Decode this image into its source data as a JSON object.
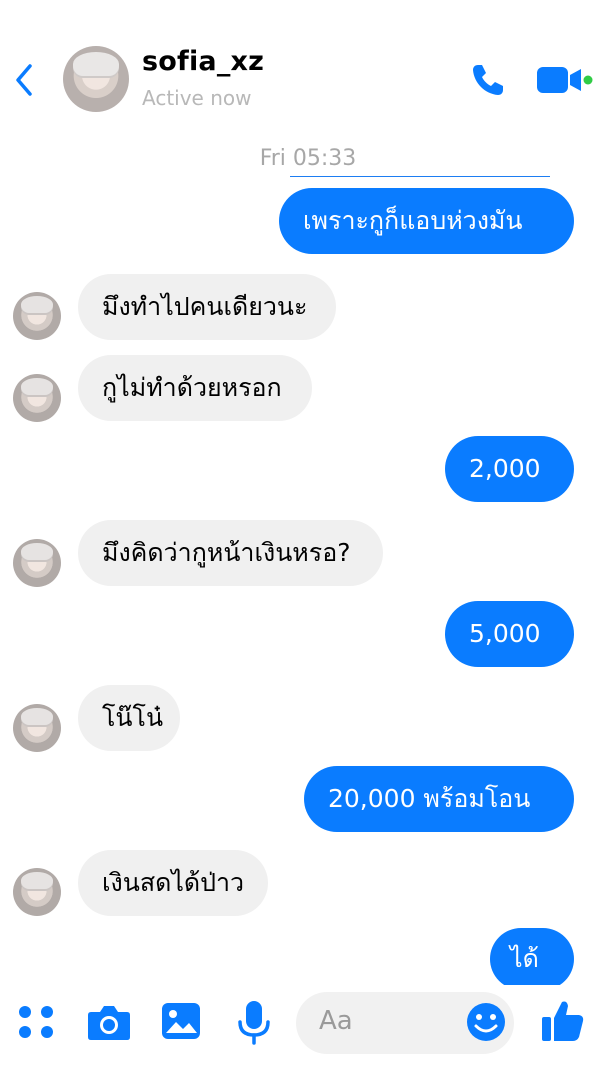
{
  "header": {
    "contact_name": "sofia_xz",
    "status": "Active now"
  },
  "thread": {
    "timestamp": "Fri 05:33",
    "messages": [
      {
        "direction": "outgoing",
        "text": "เพราะกูก็แอบห่วงมัน"
      },
      {
        "direction": "incoming",
        "text": "มึงทำไปคนเดียวนะ"
      },
      {
        "direction": "incoming",
        "text": "กูไม่ทำด้วยหรอก"
      },
      {
        "direction": "outgoing",
        "text": "2,000"
      },
      {
        "direction": "incoming",
        "text": "มึงคิดว่ากูหน้าเงินหรอ?"
      },
      {
        "direction": "outgoing",
        "text": "5,000"
      },
      {
        "direction": "incoming",
        "text": "โน๊โน๋"
      },
      {
        "direction": "outgoing",
        "text": "20,000 พร้อมโอน"
      },
      {
        "direction": "incoming",
        "text": "เงินสดได้ป่าว"
      },
      {
        "direction": "outgoing",
        "text": "ได้"
      }
    ]
  },
  "composer": {
    "placeholder": "Aa",
    "icons": [
      "apps-icon",
      "camera-icon",
      "image-icon",
      "microphone-icon",
      "emoji-icon",
      "thumbs-up-icon"
    ]
  },
  "colors": {
    "accent": "#0a7cff",
    "incoming_bubble": "#f0f0f0",
    "online": "#31cc46"
  }
}
